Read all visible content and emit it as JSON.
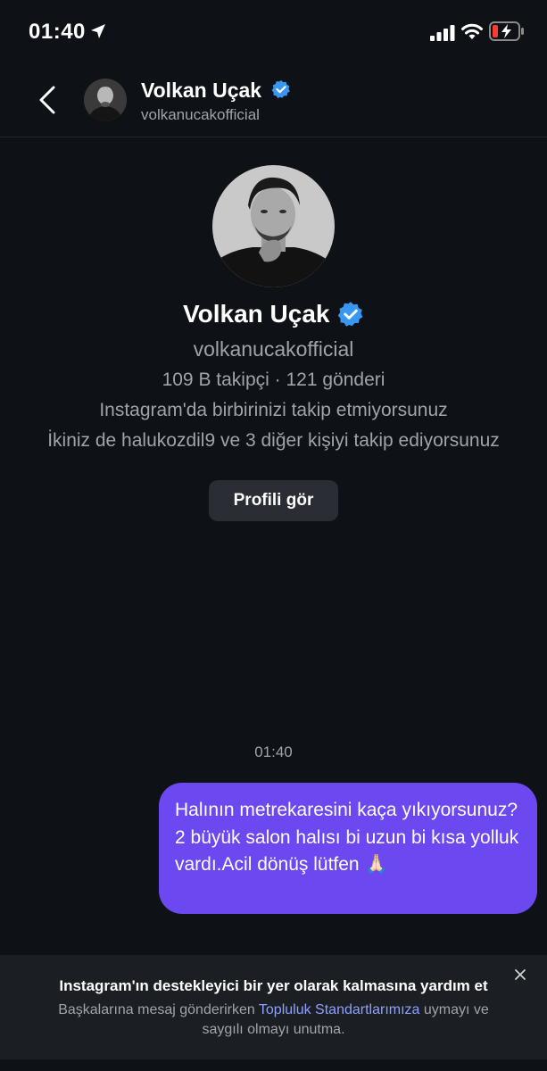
{
  "status_bar": {
    "time": "01:40"
  },
  "header": {
    "name": "Volkan Uçak",
    "username": "volkanucakofficial"
  },
  "profile": {
    "name": "Volkan Uçak",
    "username": "volkanucakofficial",
    "stats": "109 B takipçi · 121 gönderi",
    "follow_status": "Instagram'da birbirinizi takip etmiyorsunuz",
    "mutual": "İkiniz de halukozdil9 ve 3 diğer kişiyi takip ediyorsunuz",
    "view_profile_label": "Profili gör"
  },
  "chat": {
    "timestamp": "01:40",
    "messages": [
      {
        "text": "Halının metrekaresini kaça yıkıyorsunuz?2 büyük salon halısı bi uzun bi kısa yolluk vardı.Acil dönüş lütfen 🙏🏻",
        "sent": true
      }
    ]
  },
  "notice": {
    "title": "Instagram'ın destekleyici bir yer olarak kalmasına yardım et",
    "body_before": "Başkalarına mesaj gönderirken ",
    "link_text": "Topluluk Standartlarımıza",
    "body_after": " uymayı ve saygılı olmayı unutma."
  },
  "colors": {
    "background": "#0e1116",
    "bubble": "#6b48f0",
    "verified": "#3897f0",
    "link": "#8ea0ff",
    "battery_low": "#ff3b30"
  },
  "icons": [
    "location-arrow-icon",
    "signal-icon",
    "wifi-icon",
    "battery-low-icon",
    "back-chevron-icon",
    "verified-badge-icon",
    "close-icon"
  ]
}
